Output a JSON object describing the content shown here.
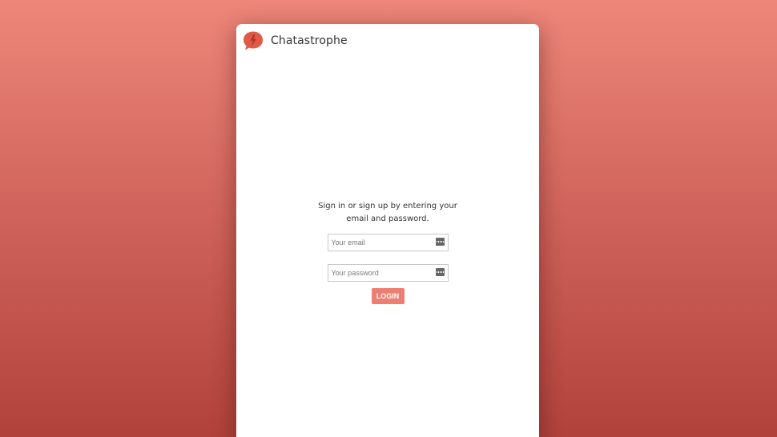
{
  "app": {
    "title": "Chatastrophe",
    "logo_icon": "speech-bubble-logo-icon",
    "brand_color": "#e05a48"
  },
  "login": {
    "instructions": "Sign in or sign up by entering your email and password.",
    "email_placeholder": "Your email",
    "email_value": "",
    "password_placeholder": "Your password",
    "password_value": "",
    "field_icon": "password-manager-key-icon",
    "button_label": "LOGIN",
    "button_color": "#ec7f72"
  }
}
